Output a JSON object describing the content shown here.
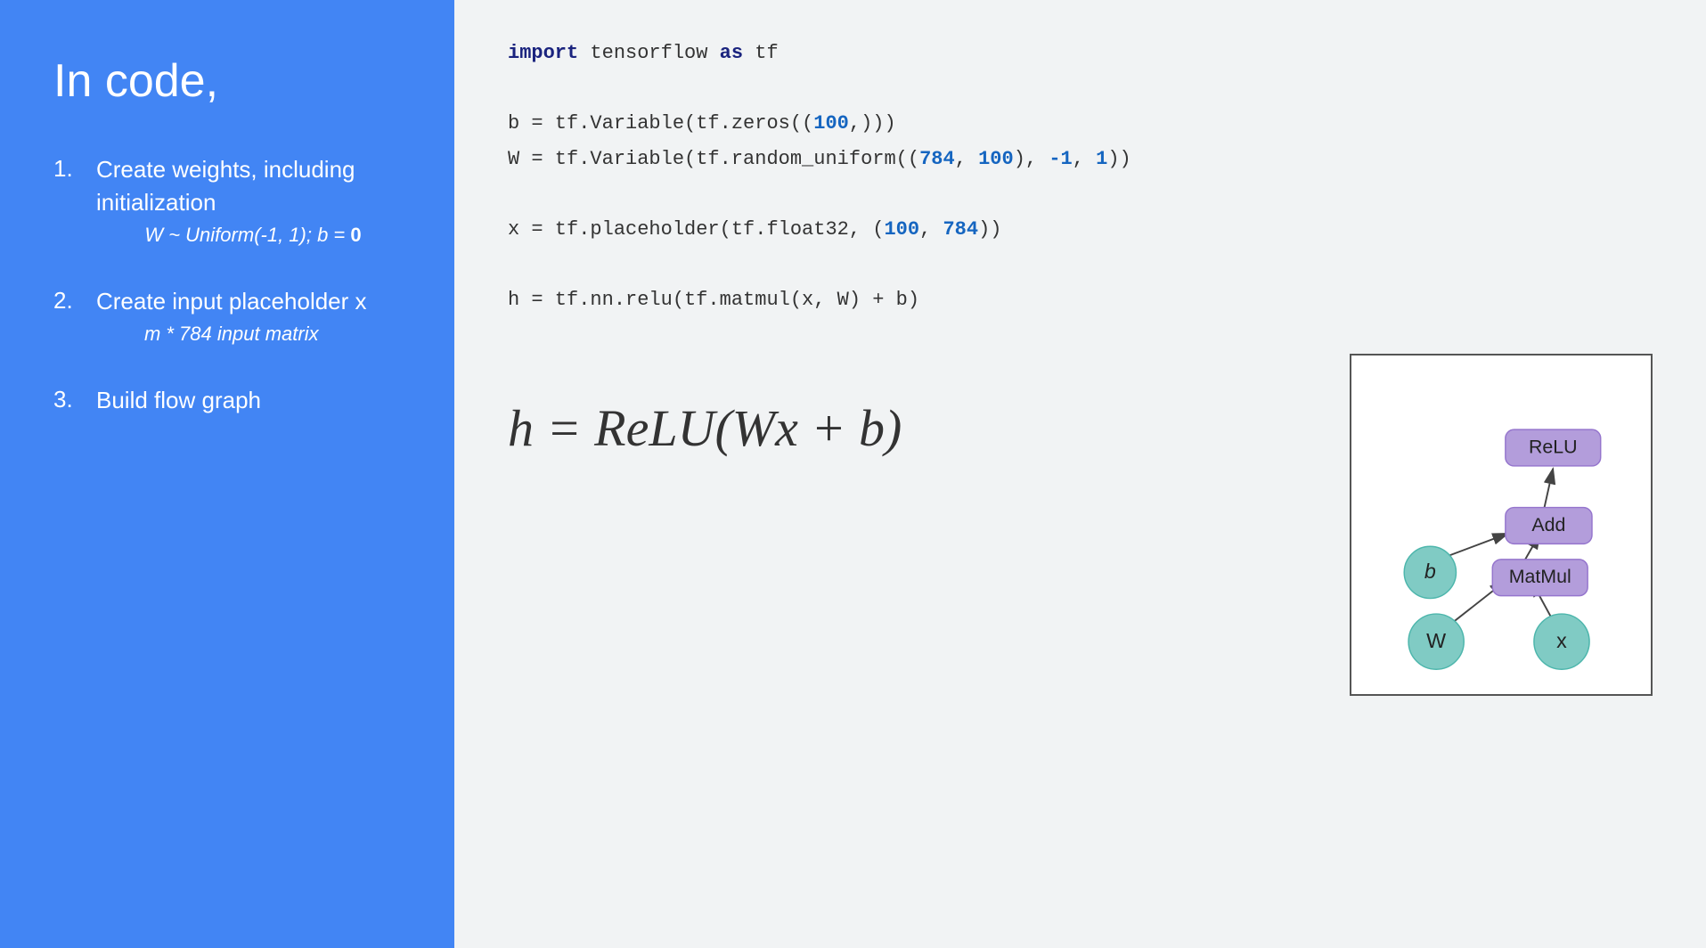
{
  "left": {
    "title": "In code,",
    "items": [
      {
        "number": "1.",
        "main": "Create weights, including initialization",
        "sub": "W ~ Uniform(-1, 1); b = 0"
      },
      {
        "number": "2.",
        "main": "Create input placeholder x",
        "sub": "m * 784 input matrix"
      },
      {
        "number": "3.",
        "main": "Build flow graph",
        "sub": ""
      }
    ]
  },
  "right": {
    "code": {
      "line1": "import tensorflow as tf",
      "line2": "",
      "line3": "b = tf.Variable(tf.zeros((100,)))",
      "line4": "W = tf.Variable(tf.random_uniform((784, 100), -1, 1))",
      "line5": "",
      "line6": "x = tf.placeholder(tf.float32, (100, 784))",
      "line7": "",
      "line8": "h = tf.nn.relu(tf.matmul(x, W) + b)"
    },
    "formula": "h = ReLU(Wx + b)",
    "graph": {
      "nodes": [
        "ReLU",
        "Add",
        "b",
        "MatMul",
        "W",
        "x"
      ],
      "edges": [
        [
          "MatMul",
          "Add"
        ],
        [
          "b",
          "Add"
        ],
        [
          "Add",
          "ReLU"
        ],
        [
          "W",
          "MatMul"
        ],
        [
          "x",
          "MatMul"
        ]
      ]
    }
  }
}
